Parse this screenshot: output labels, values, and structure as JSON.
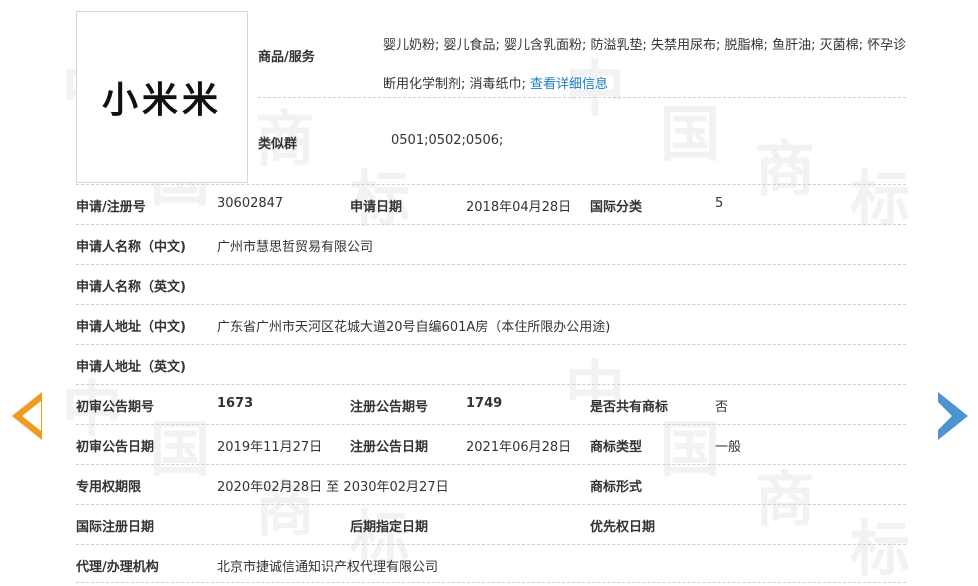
{
  "trademark": {
    "logo_text": "小米米"
  },
  "goods": {
    "label": "商品/服务",
    "text": "婴儿奶粉; 婴儿食品; 婴儿含乳面粉; 防溢乳垫; 失禁用尿布; 脱脂棉; 鱼肝油; 灭菌棉; 怀孕诊断用化学制剂; 消毒纸巾;",
    "link": "查看详细信息"
  },
  "similar_group": {
    "label": "类似群",
    "value": "0501;0502;0506;"
  },
  "fields": {
    "reg_no": {
      "label": "申请/注册号",
      "value": "30602847"
    },
    "apply_date": {
      "label": "申请日期",
      "value": "2018年04月28日"
    },
    "intl_class": {
      "label": "国际分类",
      "value": "5"
    },
    "applicant_cn": {
      "label": "申请人名称（中文)",
      "value": "广州市慧思哲贸易有限公司"
    },
    "applicant_en": {
      "label": "申请人名称（英文)",
      "value": ""
    },
    "address_cn": {
      "label": "申请人地址（中文)",
      "value": "广东省广州市天河区花城大道20号自编601A房（本住所限办公用途)"
    },
    "address_en": {
      "label": "申请人地址（英文)",
      "value": ""
    },
    "prelim_issue": {
      "label": "初审公告期号",
      "value": "1673"
    },
    "reg_issue": {
      "label": "注册公告期号",
      "value": "1749"
    },
    "shared": {
      "label": "是否共有商标",
      "value": "否"
    },
    "prelim_date": {
      "label": "初审公告日期",
      "value": "2019年11月27日"
    },
    "reg_date": {
      "label": "注册公告日期",
      "value": "2021年06月28日"
    },
    "tm_type": {
      "label": "商标类型",
      "value": "一般"
    },
    "exclusive_period": {
      "label": "专用权期限",
      "value": "2020年02月28日 至 2030年02月27日"
    },
    "tm_form": {
      "label": "商标形式",
      "value": ""
    },
    "intl_reg_date": {
      "label": "国际注册日期",
      "value": ""
    },
    "later_designation": {
      "label": "后期指定日期",
      "value": ""
    },
    "priority_date": {
      "label": "优先权日期",
      "value": ""
    },
    "agent": {
      "label": "代理/办理机构",
      "value": "北京市捷诚信通知识产权代理有限公司"
    }
  },
  "watermark": {
    "text": [
      "中",
      "国",
      "商",
      "标"
    ]
  },
  "nav": {
    "prev": "arrow-left-icon",
    "next": "arrow-right-icon"
  },
  "colors": {
    "link": "#1a7ec4",
    "prev_arrow": "#f39a1e",
    "next_arrow": "#4d93d1",
    "divider": "#cfcfcf"
  }
}
